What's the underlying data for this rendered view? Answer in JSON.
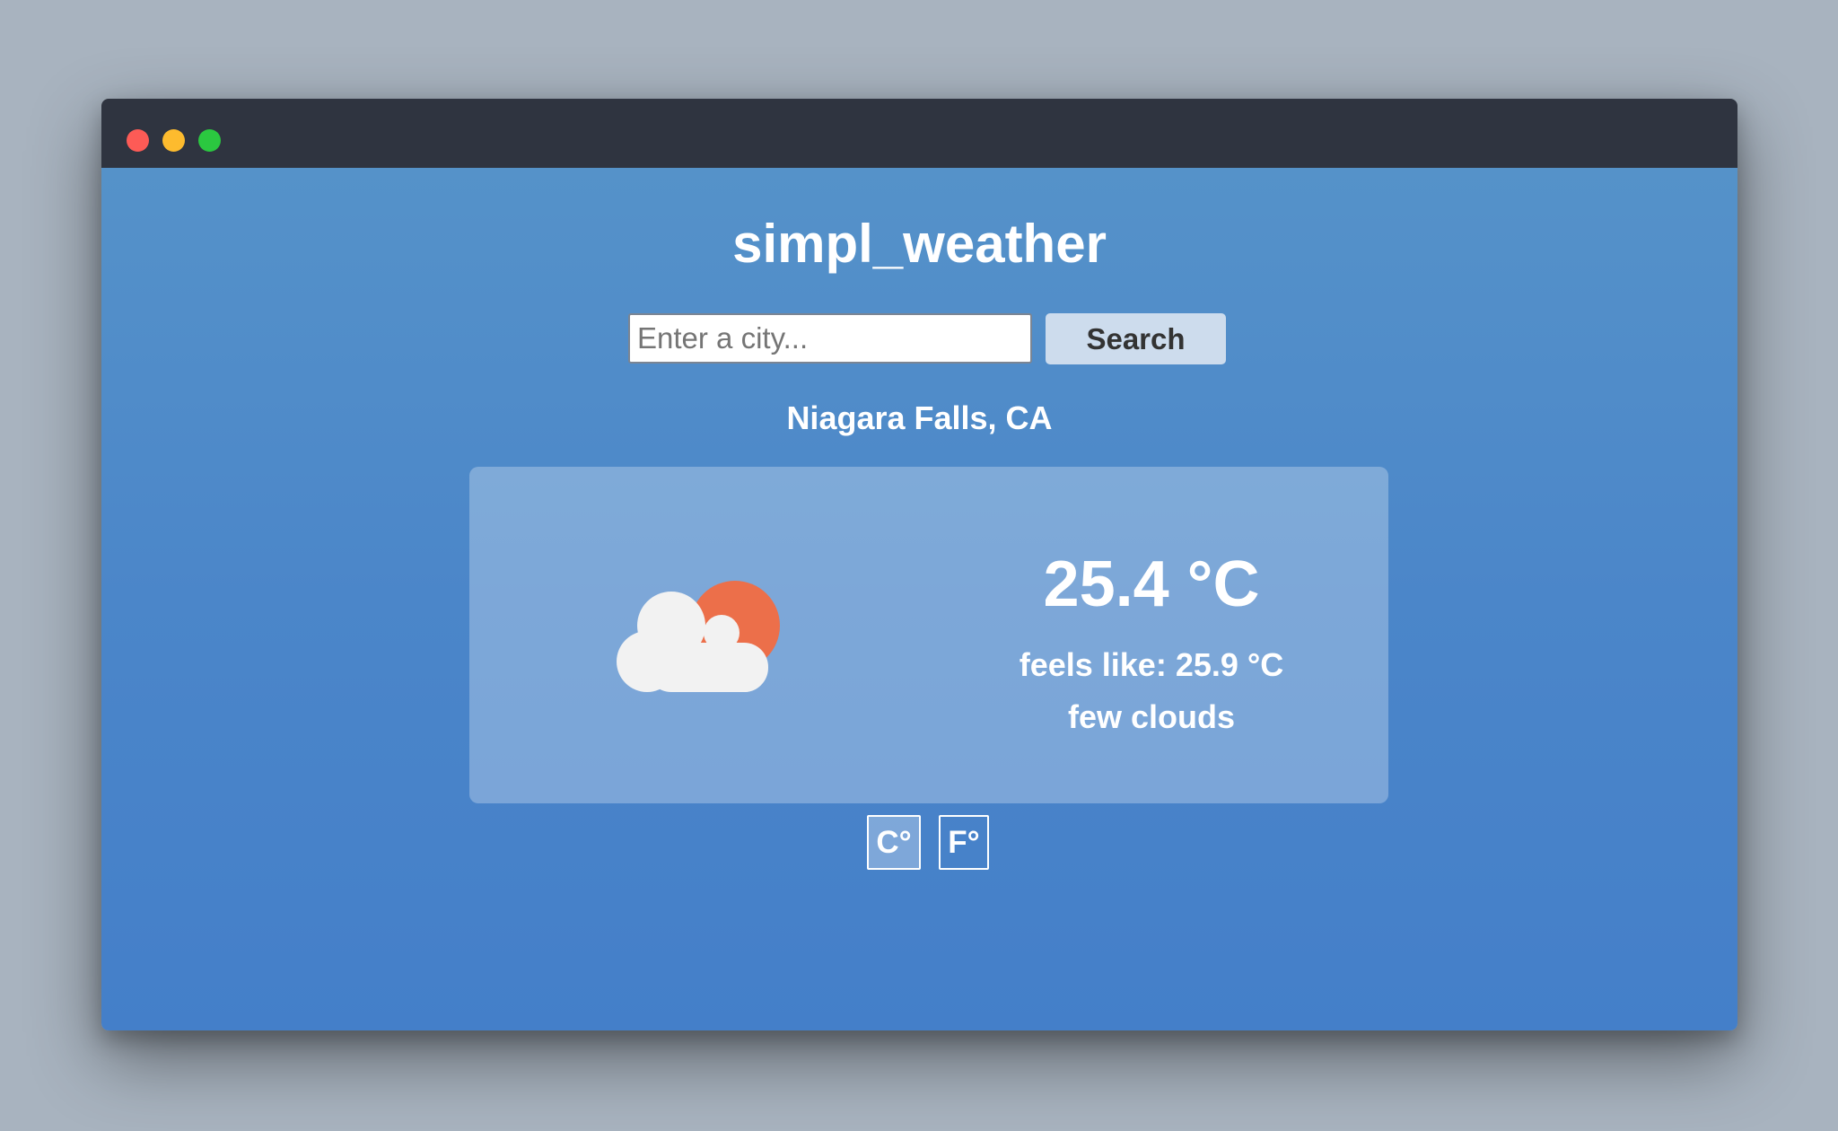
{
  "app": {
    "title": "simpl_weather"
  },
  "search": {
    "placeholder": "Enter a city...",
    "value": "",
    "button_label": "Search"
  },
  "weather": {
    "location": "Niagara Falls, CA",
    "temperature": "25.4 °C",
    "feels_like": "feels like: 25.9 °C",
    "description": "few clouds",
    "icon": "partly-cloudy-icon"
  },
  "units": {
    "celsius_label": "C°",
    "fahrenheit_label": "F°",
    "selected": "celsius"
  },
  "colors": {
    "titlebar": "#2f3440",
    "background_top": "#5592c9",
    "background_bottom": "#447fc9",
    "sun": "#ec6f4a",
    "cloud": "#f2f2f2",
    "search_button": "#cddced"
  }
}
